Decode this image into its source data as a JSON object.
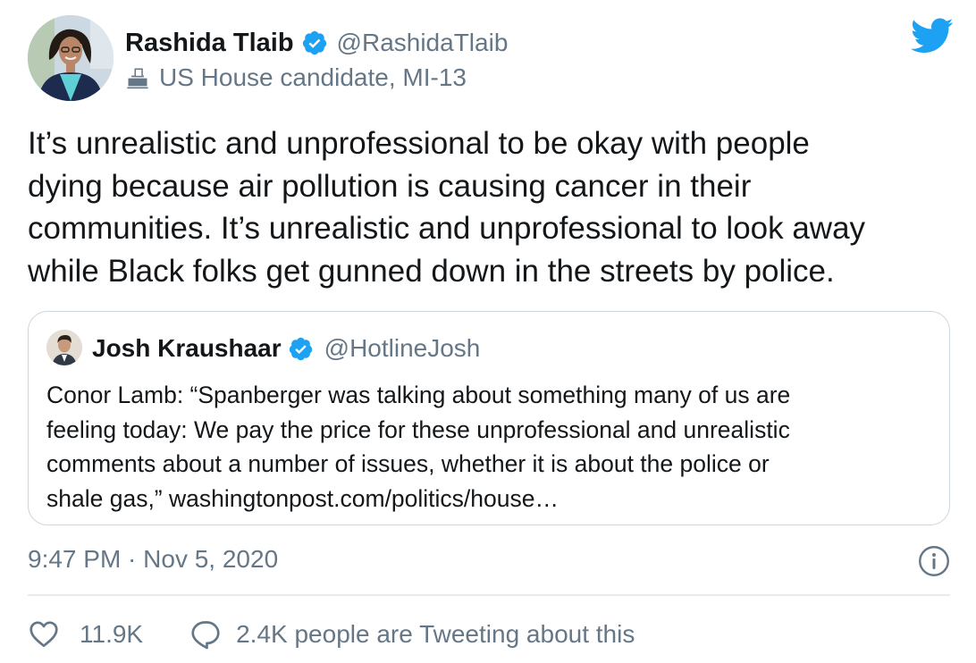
{
  "tweet": {
    "author": {
      "display_name": "Rashida Tlaib",
      "handle": "@RashidaTlaib",
      "label": "US House candidate, MI-13",
      "verified": true
    },
    "text": "It’s unrealistic and unprofessional to be okay with people\ndying because air pollution is causing cancer in their\ncommunities. It’s unrealistic and unprofessional to look away\nwhile Black folks get gunned down in the streets by police.",
    "quoted": {
      "author": {
        "display_name": "Josh Kraushaar",
        "handle": "@HotlineJosh",
        "verified": true
      },
      "text": "Conor Lamb: “Spanberger was talking about something many of us are\nfeeling today: We pay the price for these unprofessional and unrealistic\ncomments about a number of issues, whether it is about the police or\nshale gas,” washingtonpost.com/politics/house…"
    },
    "timestamp": "9:47 PM · Nov 5, 2020",
    "likes": "11.9K",
    "conversation": "2.4K people are Tweeting about this"
  },
  "icons": {
    "brand": "twitter-bird-icon",
    "verified": "verified-badge-icon",
    "label": "ballot-box-icon",
    "info": "info-icon",
    "like": "heart-icon",
    "reply": "speech-bubble-icon"
  },
  "colors": {
    "brand_blue": "#1da1f2",
    "text_primary": "#14171a",
    "text_secondary": "#657786",
    "border": "#ccd6dd"
  }
}
